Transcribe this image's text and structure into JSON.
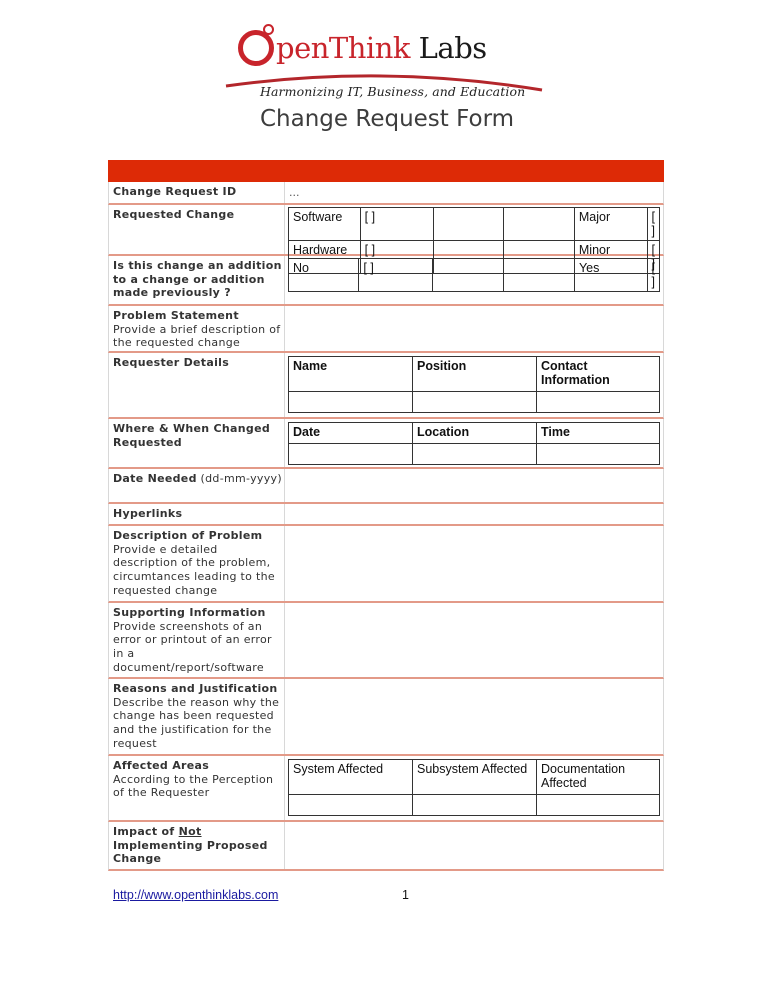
{
  "header": {
    "logo": {
      "brand_red": "penThink",
      "brand_dark": "Labs",
      "icon": "o-ring-logo-icon"
    },
    "tagline": "Harmonizing IT, Business, and Education",
    "title": "Change Request Form"
  },
  "colors": {
    "accent": "#dd2a06",
    "row_border": "#e39a88",
    "logo_red": "#c8242b"
  },
  "form": {
    "change_request_id": {
      "label": "Change Request ID",
      "value": "..."
    },
    "requested_change": {
      "label": "Requested Change",
      "rows": [
        {
          "type": "Software",
          "type_box": "[ ]",
          "size": "Major",
          "size_box": "[ ]"
        },
        {
          "type": "Hardware",
          "type_box": "[ ]",
          "size": "Minor",
          "size_box": "[ ]"
        }
      ]
    },
    "addition": {
      "label": "Is this change an addition to a change or addition made previously ?",
      "no": "No",
      "no_box": "[ ]",
      "yes": "Yes",
      "yes_box": "[ ]"
    },
    "problem_statement": {
      "label": "Problem Statement",
      "hint": "Provide a brief description of the requested change"
    },
    "requester_details": {
      "label": "Requester Details",
      "columns": [
        "Name",
        "Position",
        "Contact Information"
      ]
    },
    "where_when": {
      "label": "Where & When Changed Requested",
      "columns": [
        "Date",
        "Location",
        "Time"
      ]
    },
    "date_needed": {
      "label": "Date Needed",
      "hint": "(dd-mm-yyyy)"
    },
    "hyperlinks": {
      "label": "Hyperlinks"
    },
    "description": {
      "label": "Description of Problem",
      "hint": "Provide e detailed description of the problem, circumtances leading to the requested change"
    },
    "supporting": {
      "label": "Supporting Information",
      "hint": "Provide screenshots of an error or printout of an error in a document/report/software"
    },
    "reasons": {
      "label": "Reasons and Justification",
      "hint": "Describe the reason why the change has been requested and the justification for the request"
    },
    "affected_areas": {
      "label": "Affected Areas",
      "hint": "According to the Perception of the Requester",
      "columns": [
        "System Affected",
        "Subsystem Affected",
        "Documentation Affected"
      ]
    },
    "impact": {
      "label_pre": "Impact of ",
      "label_underlined": "Not ",
      "label_post": "Implementing Proposed Change"
    }
  },
  "footer": {
    "link": "http://www.openthinklabs.com",
    "page_number": "1"
  }
}
